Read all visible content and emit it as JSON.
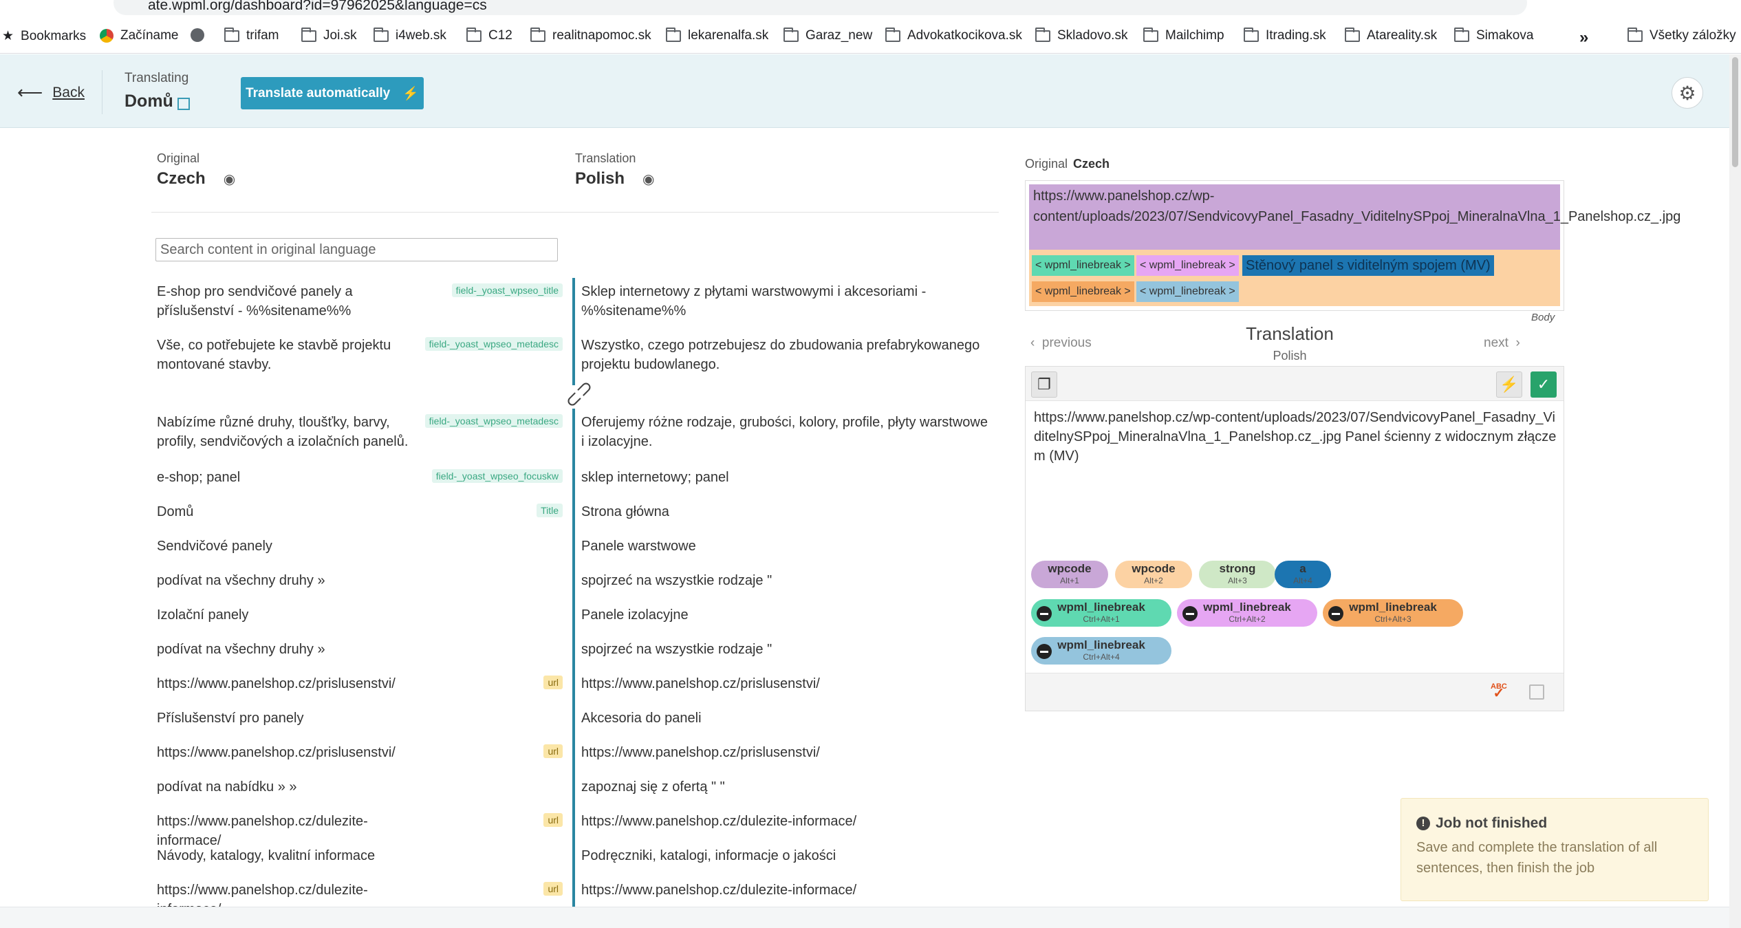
{
  "browser": {
    "url": "ate.wpml.org/dashboard?id=97962025&language=cs",
    "bookmarks": [
      {
        "label": "Bookmarks",
        "icon": "star-icon"
      },
      {
        "label": "Začíname",
        "icon": "chrome-icon"
      },
      {
        "label": "",
        "icon": "globe-icon"
      },
      {
        "label": "trifam",
        "icon": "folder-icon"
      },
      {
        "label": "Joi.sk",
        "icon": "folder-icon"
      },
      {
        "label": "i4web.sk",
        "icon": "folder-icon"
      },
      {
        "label": "C12",
        "icon": "folder-icon"
      },
      {
        "label": "realitnapomoc.sk",
        "icon": "folder-icon"
      },
      {
        "label": "lekarenalfa.sk",
        "icon": "folder-icon"
      },
      {
        "label": "Garaz_new",
        "icon": "folder-icon"
      },
      {
        "label": "Advokatkocikova.sk",
        "icon": "folder-icon"
      },
      {
        "label": "Skladovo.sk",
        "icon": "folder-icon"
      },
      {
        "label": "Mailchimp",
        "icon": "folder-icon"
      },
      {
        "label": "Itrading.sk",
        "icon": "folder-icon"
      },
      {
        "label": "Atareality.sk",
        "icon": "folder-icon"
      },
      {
        "label": "Simakova",
        "icon": "folder-icon"
      }
    ],
    "more": "»",
    "all_bookmarks": "Všetky záložky"
  },
  "header": {
    "back": "Back",
    "translating_label": "Translating",
    "document_title": "Domů",
    "translate_auto": "Translate automatically"
  },
  "columns": {
    "original_label": "Original",
    "original_lang": "Czech",
    "translation_label": "Translation",
    "translation_lang": "Polish"
  },
  "search": {
    "placeholder": "Search content in original language"
  },
  "rows": [
    {
      "orig": "E-shop pro sendvičové panely a příslušenství - %%sitename%%",
      "tag": "field-_yoast_wpseo_title",
      "trans": "Sklep internetowy z płytami warstwowymi i akcesoriami - %%sitename%%"
    },
    {
      "orig": "Vše, co potřebujete ke stavbě projektu montované stavby.",
      "tag": "field-_yoast_wpseo_metadesc",
      "trans": "Wszystko, czego potrzebujesz do zbudowania prefabrykowanego projektu budowlanego."
    },
    {
      "orig": "Nabízíme různé druhy, tloušťky, barvy, profily, sendvičových a izolačních panelů.",
      "tag": "field-_yoast_wpseo_metadesc",
      "trans": "Oferujemy różne rodzaje, grubości, kolory, profile, płyty warstwowe i izolacyjne."
    },
    {
      "orig": "e-shop; panel",
      "tag": "field-_yoast_wpseo_focuskw",
      "trans": "sklep internetowy; panel"
    },
    {
      "orig": "Domů",
      "tag": "Title",
      "trans": "Strona główna"
    },
    {
      "orig": "Sendvičové panely",
      "tag": "",
      "trans": "Panele warstwowe"
    },
    {
      "orig": "podívat na všechny druhy »",
      "tag": "",
      "trans": "spojrzeć na wszystkie rodzaje \""
    },
    {
      "orig": "Izolační panely",
      "tag": "",
      "trans": "Panele izolacyjne"
    },
    {
      "orig": "podívat na všechny druhy »",
      "tag": "",
      "trans": "spojrzeć na wszystkie rodzaje \""
    },
    {
      "orig": "https://www.panelshop.cz/prislusenstvi/",
      "tag": "url",
      "trans": "https://www.panelshop.cz/prislusenstvi/"
    },
    {
      "orig": "Příslušenství pro panely",
      "tag": "",
      "trans": "Akcesoria do paneli"
    },
    {
      "orig": "https://www.panelshop.cz/prislusenstvi/",
      "tag": "url",
      "trans": "https://www.panelshop.cz/prislusenstvi/"
    },
    {
      "orig": "podívat na nabídku » »",
      "tag": "",
      "trans": "zapoznaj się z ofertą \" \""
    },
    {
      "orig": "https://www.panelshop.cz/dulezite-informace/",
      "tag": "url",
      "trans": "https://www.panelshop.cz/dulezite-informace/"
    },
    {
      "orig": "Návody, katalogy, kvalitní informace",
      "tag": "",
      "trans": "Podręczniki, katalogi, informacje o jakości"
    },
    {
      "orig": "https://www.panelshop.cz/dulezite-informace/",
      "tag": "url",
      "trans": "https://www.panelshop.cz/dulezite-informace/"
    }
  ],
  "panel": {
    "original_label": "Original",
    "original_lang": "Czech",
    "source_url": "https://www.panelshop.cz/wp-content/uploads/2023/07/SendvicovyPanel_Fasadny_ViditelnySPpoj_MineralnaVlna_1_Panelshop.cz_.jpg",
    "chips": [
      "< wpml_linebreak >",
      "< wpml_linebreak >",
      "Stěnový panel s viditelným spojem (MV)",
      "< wpml_linebreak >",
      "< wpml_linebreak >"
    ],
    "body_label": "Body",
    "previous": "previous",
    "next": "next",
    "translation_title": "Translation",
    "translation_lang": "Polish",
    "translation_text": "https://www.panelshop.cz/wp-content/uploads/2023/07/SendvicovyPanel_Fasadny_ViditelnySPpoj_MineralnaVlna_1_Panelshop.cz_.jpg  Panel ścienny z widocznym złączem (MV)",
    "format_pills": [
      {
        "name": "wpcode",
        "shortcut": "Alt+1",
        "color": "#c9a7d7"
      },
      {
        "name": "wpcode",
        "shortcut": "Alt+2",
        "color": "#fcd2a3"
      },
      {
        "name": "strong",
        "shortcut": "Alt+3",
        "color": "#cfe8c6"
      },
      {
        "name": "a",
        "shortcut": "Alt+4",
        "color": "#1c75b1"
      }
    ],
    "linebreak_pills": [
      {
        "name": "wpml_linebreak",
        "shortcut": "Ctrl+Alt+1",
        "color": "#5fd9b1"
      },
      {
        "name": "wpml_linebreak",
        "shortcut": "Ctrl+Alt+2",
        "color": "#e6a6f3"
      },
      {
        "name": "wpml_linebreak",
        "shortcut": "Ctrl+Alt+3",
        "color": "#f5a962"
      },
      {
        "name": "wpml_linebreak",
        "shortcut": "Ctrl+Alt+4",
        "color": "#94c4dd"
      }
    ],
    "spellcheck": "ABC"
  },
  "notice": {
    "title": "Job not finished",
    "body": "Save and complete the translation of all sentences, then finish the job"
  },
  "colors": {
    "accent": "#2d9bbd",
    "row_bar": "#2a86a1",
    "confirm": "#28a36b"
  }
}
